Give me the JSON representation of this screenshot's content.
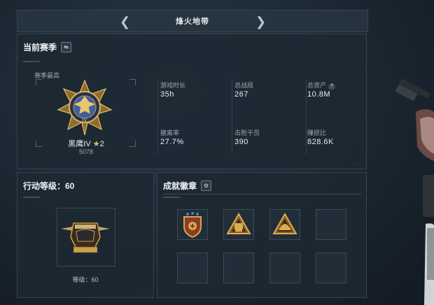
{
  "header": {
    "title": "烽火地带"
  },
  "season": {
    "title": "当前赛季",
    "best_label": "赛季最高",
    "rank_name": "黑鹰IV",
    "rank_stars": "2",
    "rank_points": "5078",
    "stats": [
      {
        "label": "游戏时长",
        "value": "35h"
      },
      {
        "label": "总战局",
        "value": "267"
      },
      {
        "label": "总资产",
        "value": "10.8M"
      },
      {
        "label": "撤离率",
        "value": "27.7%"
      },
      {
        "label": "击败干员",
        "value": "390"
      },
      {
        "label": "赚损比",
        "value": "828.6K"
      }
    ]
  },
  "action_level": {
    "title": "行动等级：60",
    "level_caption": "等级：60"
  },
  "achievements": {
    "title": "成就徽章",
    "badges": [
      "badge-shield-icon",
      "badge-triangle-skull-icon",
      "badge-triangle-helmet-icon",
      "",
      "",
      "",
      "",
      ""
    ]
  },
  "colors": {
    "gold": "#c9a24a",
    "panel": "#1c2832",
    "accent_blue": "#3f5ea6"
  }
}
